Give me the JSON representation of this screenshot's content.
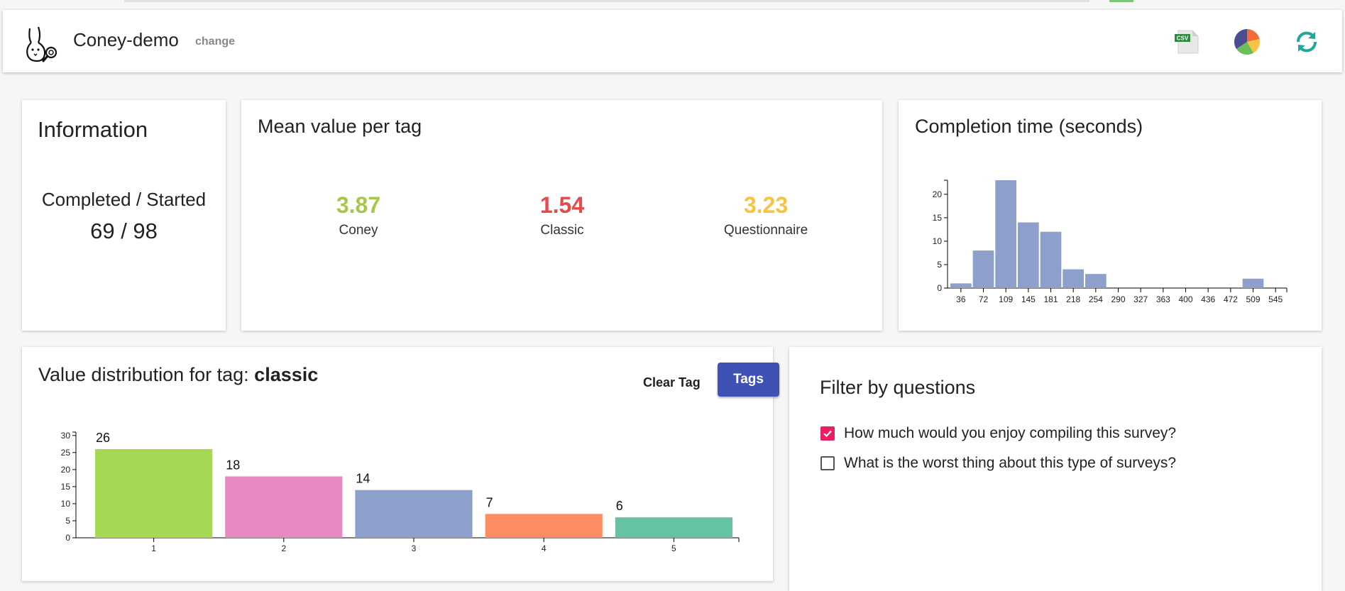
{
  "header": {
    "title": "Coney-demo",
    "change_label": "change",
    "csv_icon_text": "CSV"
  },
  "info": {
    "title": "Information",
    "label": "Completed / Started",
    "value": "69 / 98"
  },
  "mean": {
    "title": "Mean value per tag",
    "items": [
      {
        "value": "3.87",
        "label": "Coney",
        "color": "#a6c84a"
      },
      {
        "value": "1.54",
        "label": "Classic",
        "color": "#e24c4b"
      },
      {
        "value": "3.23",
        "label": "Questionnaire",
        "color": "#f6c343"
      }
    ]
  },
  "completion": {
    "title": "Completion time (seconds)"
  },
  "distribution": {
    "title_prefix": "Value distribution for tag: ",
    "title_tag": "classic",
    "clear_label": "Clear Tag",
    "tags_label": "Tags"
  },
  "filter": {
    "title": "Filter by questions",
    "questions": [
      {
        "label": "How much would you enjoy compiling this survey?",
        "checked": true
      },
      {
        "label": "What is the worst thing about this type of surveys?",
        "checked": false
      }
    ]
  },
  "colors": {
    "accent": "#3f51b5",
    "checkbox": "#e91e63",
    "histogram_bar": "#8da0cb"
  },
  "chart_data": [
    {
      "type": "bar",
      "categories": [
        "36",
        "72",
        "109",
        "145",
        "181",
        "218",
        "254",
        "290",
        "327",
        "363",
        "400",
        "436",
        "472",
        "509",
        "545"
      ],
      "values": [
        1,
        8,
        23,
        14,
        12,
        4,
        3,
        0,
        0,
        0,
        0,
        0,
        0,
        2,
        0
      ],
      "ylim": [
        0,
        23
      ],
      "yticks": [
        0,
        5,
        10,
        15,
        20
      ],
      "color": "#8da0cb",
      "grid": false
    },
    {
      "type": "bar",
      "categories": [
        "1",
        "2",
        "3",
        "4",
        "5"
      ],
      "values": [
        26,
        18,
        14,
        7,
        6
      ],
      "ylim": [
        0,
        31
      ],
      "yticks": [
        0,
        5,
        10,
        15,
        20,
        25,
        30
      ],
      "colors": [
        "#a6d854",
        "#e78ac3",
        "#8da0cb",
        "#fc8d62",
        "#66c2a5"
      ],
      "data_labels": true,
      "grid": false
    }
  ]
}
